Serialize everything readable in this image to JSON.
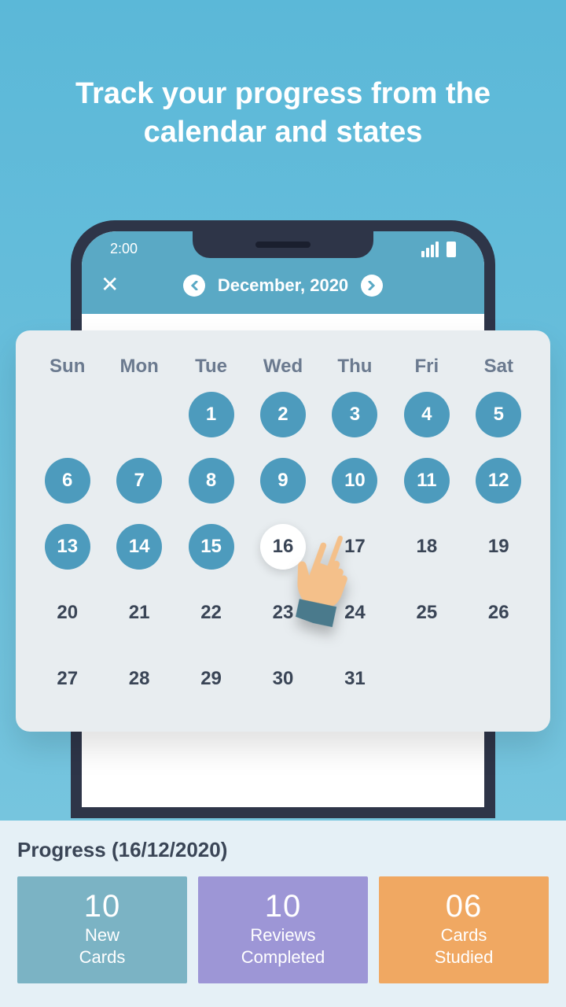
{
  "headline": "Track your progress from the calendar and states",
  "status": {
    "time": "2:00"
  },
  "header": {
    "month_label": "December, 2020"
  },
  "calendar": {
    "dow": [
      "Sun",
      "Mon",
      "Tue",
      "Wed",
      "Thu",
      "Fri",
      "Sat"
    ],
    "rows": [
      [
        {
          "n": "",
          "s": ""
        },
        {
          "n": "",
          "s": ""
        },
        {
          "n": "1",
          "s": "filled"
        },
        {
          "n": "2",
          "s": "filled"
        },
        {
          "n": "3",
          "s": "filled"
        },
        {
          "n": "4",
          "s": "filled"
        },
        {
          "n": "5",
          "s": "filled"
        }
      ],
      [
        {
          "n": "6",
          "s": "filled"
        },
        {
          "n": "7",
          "s": "filled"
        },
        {
          "n": "8",
          "s": "filled"
        },
        {
          "n": "9",
          "s": "filled"
        },
        {
          "n": "10",
          "s": "filled"
        },
        {
          "n": "11",
          "s": "filled"
        },
        {
          "n": "12",
          "s": "filled"
        }
      ],
      [
        {
          "n": "13",
          "s": "filled"
        },
        {
          "n": "14",
          "s": "filled"
        },
        {
          "n": "15",
          "s": "filled"
        },
        {
          "n": "16",
          "s": "selected"
        },
        {
          "n": "17",
          "s": ""
        },
        {
          "n": "18",
          "s": ""
        },
        {
          "n": "19",
          "s": ""
        }
      ],
      [
        {
          "n": "20",
          "s": ""
        },
        {
          "n": "21",
          "s": ""
        },
        {
          "n": "22",
          "s": ""
        },
        {
          "n": "23",
          "s": ""
        },
        {
          "n": "24",
          "s": ""
        },
        {
          "n": "25",
          "s": ""
        },
        {
          "n": "26",
          "s": ""
        }
      ],
      [
        {
          "n": "27",
          "s": ""
        },
        {
          "n": "28",
          "s": ""
        },
        {
          "n": "29",
          "s": ""
        },
        {
          "n": "30",
          "s": ""
        },
        {
          "n": "31",
          "s": ""
        },
        {
          "n": "",
          "s": ""
        },
        {
          "n": "",
          "s": ""
        }
      ]
    ]
  },
  "progress": {
    "title": "Progress (16/12/2020)",
    "stats": [
      {
        "num": "10",
        "label1": "New",
        "label2": "Cards"
      },
      {
        "num": "10",
        "label1": "Reviews",
        "label2": "Completed"
      },
      {
        "num": "06",
        "label1": "Cards",
        "label2": "Studied"
      }
    ]
  }
}
